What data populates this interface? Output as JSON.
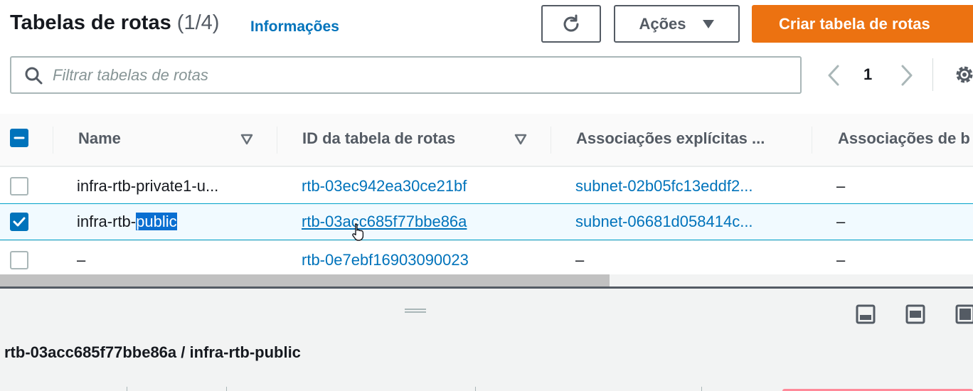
{
  "header": {
    "title": "Tabelas de rotas",
    "count": "(1/4)",
    "info_link": "Informações",
    "actions_label": "Ações",
    "create_label": "Criar tabela de rotas"
  },
  "search": {
    "placeholder": "Filtrar tabelas de rotas"
  },
  "pagination": {
    "current_page": "1"
  },
  "table": {
    "columns": [
      "Name",
      "ID da tabela de rotas",
      "Associações explícitas ...",
      "Associações de b"
    ],
    "rows": [
      {
        "selected": false,
        "name": "infra-rtb-private1-u...",
        "id": "rtb-03ec942ea30ce21bf",
        "explicit": "subnet-02b05fc13eddf2...",
        "edge": "–"
      },
      {
        "selected": true,
        "name_prefix": "infra-rtb-",
        "name_highlight": "public",
        "id": "rtb-03acc685f77bbe86a",
        "explicit": "subnet-06681d058414c...",
        "edge": "–"
      },
      {
        "selected": false,
        "name": "–",
        "id": "rtb-0e7ebf16903090023",
        "explicit": "–",
        "edge": "–"
      }
    ]
  },
  "detail": {
    "title": "rtb-03acc685f77bbe86a / infra-rtb-public"
  },
  "icons": {
    "refresh": "refresh-icon",
    "dropdown": "caret-down-icon",
    "search": "search-icon",
    "prev": "chevron-left-icon",
    "next": "chevron-right-icon",
    "settings": "gear-icon",
    "sort": "sort-caret-icon",
    "check": "check-icon",
    "minus": "minus-icon"
  },
  "colors": {
    "accent": "#0073bb",
    "primary_button": "#ec7211",
    "selection_highlight": "#0a6fd1"
  }
}
